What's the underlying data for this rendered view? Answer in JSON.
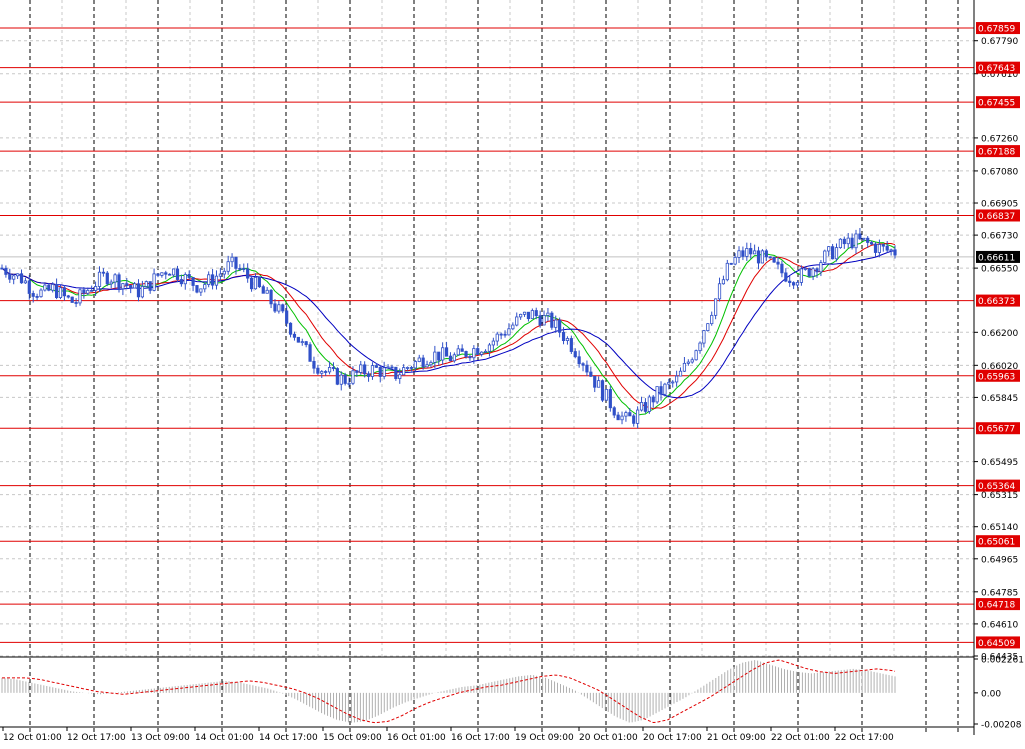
{
  "chart_data": {
    "type": "candlestick",
    "ylim": [
      0.64435,
      0.68012
    ],
    "x_tick_labels": [
      "12 Oct 01:00",
      "12 Oct 17:00",
      "13 Oct 09:00",
      "14 Oct 01:00",
      "14 Oct 17:00",
      "15 Oct 09:00",
      "16 Oct 01:00",
      "16 Oct 17:00",
      "19 Oct 09:00",
      "20 Oct 01:00",
      "20 Oct 17:00",
      "21 Oct 09:00",
      "22 Oct 01:00",
      "22 Oct 17:00"
    ],
    "y_tick_labels": [
      "0.67790",
      "0.67610",
      "0.67260",
      "0.67080",
      "0.66905",
      "0.66730",
      "0.66550",
      "0.66200",
      "0.66020",
      "0.65845",
      "0.65495",
      "0.65315",
      "0.65140",
      "0.64965",
      "0.64785",
      "0.64610",
      "0.64435"
    ],
    "grid": true,
    "current_price": "0.66611",
    "price_levels": [
      "0.67859",
      "0.67643",
      "0.67455",
      "0.67188",
      "0.66837",
      "0.66373",
      "0.65963",
      "0.65677",
      "0.65364",
      "0.65061",
      "0.64718",
      "0.64509"
    ],
    "close_series": [
      0.6655,
      0.6652,
      0.6649,
      0.6643,
      0.6641,
      0.6644,
      0.6639,
      0.6636,
      0.6642,
      0.6647,
      0.6651,
      0.6649,
      0.6646,
      0.6642,
      0.6645,
      0.6651,
      0.6655,
      0.6652,
      0.6648,
      0.6645,
      0.6648,
      0.6652,
      0.6657,
      0.6654,
      0.6648,
      0.6642,
      0.6636,
      0.6629,
      0.6621,
      0.6612,
      0.6604,
      0.6599,
      0.6596,
      0.6594,
      0.6597,
      0.6599,
      0.66,
      0.6598,
      0.6597,
      0.6601,
      0.6604,
      0.6607,
      0.6608,
      0.6606,
      0.6607,
      0.661,
      0.6612,
      0.6614,
      0.6619,
      0.6623,
      0.6628,
      0.663,
      0.6628,
      0.6625,
      0.6619,
      0.6612,
      0.6604,
      0.6594,
      0.6586,
      0.6578,
      0.6572,
      0.6574,
      0.658,
      0.6586,
      0.659,
      0.6594,
      0.6603,
      0.6614,
      0.6628,
      0.6642,
      0.6656,
      0.6662,
      0.6664,
      0.6661,
      0.6657,
      0.6653,
      0.665,
      0.6651,
      0.6655,
      0.666,
      0.6664,
      0.6668,
      0.667,
      0.6669,
      0.6667,
      0.6665,
      0.6664
    ],
    "oscillator": {
      "ylim": [
        -0.00208,
        0.002261
      ],
      "tick_labels": [
        "0.002261",
        "0.00",
        "-0.00208"
      ],
      "values": [
        0.001,
        0.0009,
        0.0007,
        0.0005,
        0.0003,
        0.0001,
        0.0,
        -0.0001,
        0.0,
        0.0001,
        0.0002,
        0.0003,
        0.0004,
        0.0005,
        0.0006,
        0.0007,
        0.0008,
        0.0007,
        0.0005,
        0.0003,
        0.0,
        -0.0004,
        -0.0009,
        -0.0014,
        -0.0018,
        -0.002,
        -0.0019,
        -0.0015,
        -0.001,
        -0.0006,
        -0.0003,
        0.0,
        0.0002,
        0.0004,
        0.0005,
        0.0007,
        0.0009,
        0.0011,
        0.0012,
        0.001,
        0.0006,
        0.0002,
        -0.0004,
        -0.001,
        -0.0016,
        -0.002,
        -0.0018,
        -0.0013,
        -0.0008,
        -0.0003,
        0.0003,
        0.0009,
        0.0015,
        0.002,
        0.0022,
        0.0019,
        0.0016,
        0.0014,
        0.0013,
        0.0014,
        0.0015,
        0.0016,
        0.0015,
        0.0013,
        0.0011
      ]
    }
  }
}
